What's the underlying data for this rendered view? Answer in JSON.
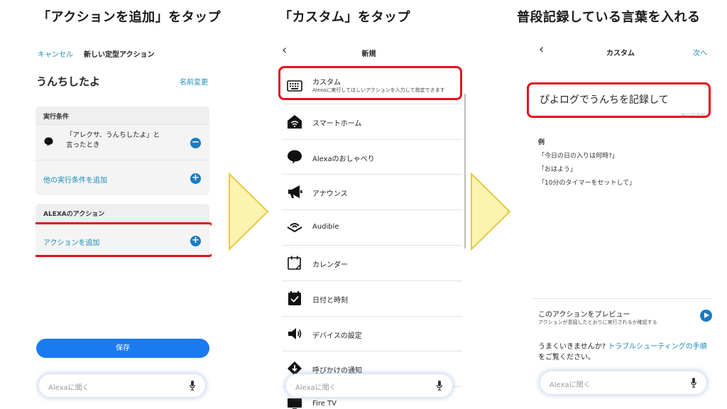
{
  "headings": {
    "step1": "「アクションを追加」をタップ",
    "step2": "「カスタム」をタップ",
    "step3": "普段記録している言葉を入れる"
  },
  "panel1": {
    "cancel": "キャンセル",
    "title": "新しい定型アクション",
    "routine_name": "うんちしたよ",
    "rename": "名前変更",
    "trigger_header": "実行条件",
    "trigger_line1": "「アレクサ、うんちしたよ」と",
    "trigger_line2": "言ったとき",
    "add_trigger": "他の実行条件を追加",
    "action_header": "ALEXAのアクション",
    "add_action": "アクションを追加",
    "save": "保存",
    "ask_placeholder": "Alexaに聞く"
  },
  "panel2": {
    "title": "新規",
    "items": [
      {
        "label": "カスタム",
        "sub": "Alexaに実行してほしいアクションを入力して指定できます",
        "icon": "keyboard-icon"
      },
      {
        "label": "スマートホーム",
        "icon": "smart-home-icon"
      },
      {
        "label": "Alexaのおしゃべり",
        "icon": "speech-bubble-icon"
      },
      {
        "label": "アナウンス",
        "icon": "megaphone-icon"
      },
      {
        "label": "Audible",
        "icon": "audible-icon"
      },
      {
        "label": "カレンダー",
        "icon": "calendar-icon"
      },
      {
        "label": "日付と時刻",
        "icon": "date-time-icon"
      },
      {
        "label": "デバイスの設定",
        "icon": "speaker-icon"
      },
      {
        "label": "呼びかけの通知",
        "icon": "notification-icon"
      },
      {
        "label": "Fire TV",
        "icon": "tv-icon"
      }
    ],
    "ask_placeholder": "Alexaに聞く"
  },
  "panel3": {
    "title": "カスタム",
    "next": "次へ",
    "input_value": "ぴよログでうんちを記録して",
    "counter": "残り文字数",
    "examples_title": "例",
    "examples": [
      "「今日の日の入りは何時?」",
      "「おはよう」",
      "「10分のタイマーをセットして」"
    ],
    "preview_title": "このアクションをプレビュー",
    "preview_sub": "アクションが意図したとおりに実行されるか確認する",
    "help_prefix": "うまくいきませんか? ",
    "help_link": "トラブルシューティングの手順",
    "help_suffix": "をご覧ください。",
    "ask_placeholder": "Alexaに聞く"
  },
  "colors": {
    "accent": "#1a7bc4",
    "link": "#1a8bb7",
    "highlight": "#e0141e",
    "arrow_fill": "#fbf3b0",
    "arrow_stroke": "#e8c940"
  }
}
